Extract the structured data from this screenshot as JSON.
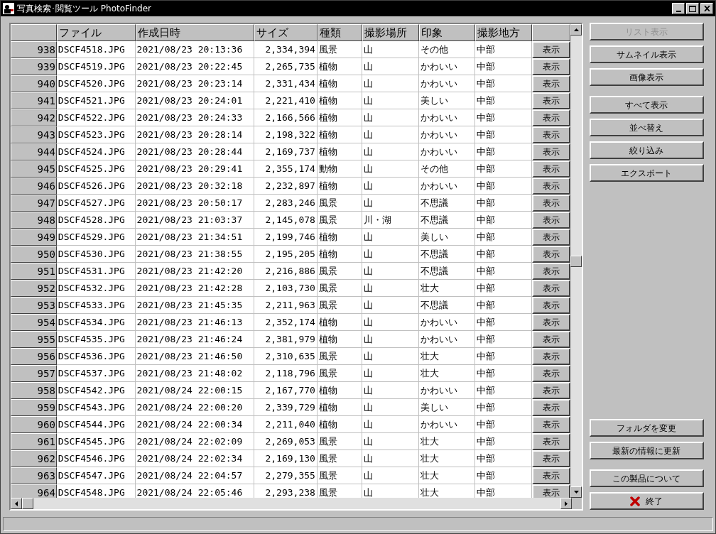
{
  "window": {
    "title": "写真検索･閲覧ツール PhotoFinder"
  },
  "table": {
    "columns": [
      "ファイル",
      "作成日時",
      "サイズ",
      "種類",
      "撮影場所",
      "印象",
      "撮影地方"
    ],
    "rows": [
      {
        "no": "938",
        "file": "DSCF4518.JPG",
        "created": "2021/08/23 20:13:36",
        "size": "2,334,394",
        "type": "風景",
        "place": "山",
        "impression": "その他",
        "region": "中部",
        "action": "表示"
      },
      {
        "no": "939",
        "file": "DSCF4519.JPG",
        "created": "2021/08/23 20:22:45",
        "size": "2,265,735",
        "type": "植物",
        "place": "山",
        "impression": "かわいい",
        "region": "中部",
        "action": "表示"
      },
      {
        "no": "940",
        "file": "DSCF4520.JPG",
        "created": "2021/08/23 20:23:14",
        "size": "2,331,434",
        "type": "植物",
        "place": "山",
        "impression": "かわいい",
        "region": "中部",
        "action": "表示"
      },
      {
        "no": "941",
        "file": "DSCF4521.JPG",
        "created": "2021/08/23 20:24:01",
        "size": "2,221,410",
        "type": "植物",
        "place": "山",
        "impression": "美しい",
        "region": "中部",
        "action": "表示"
      },
      {
        "no": "942",
        "file": "DSCF4522.JPG",
        "created": "2021/08/23 20:24:33",
        "size": "2,166,566",
        "type": "植物",
        "place": "山",
        "impression": "かわいい",
        "region": "中部",
        "action": "表示"
      },
      {
        "no": "943",
        "file": "DSCF4523.JPG",
        "created": "2021/08/23 20:28:14",
        "size": "2,198,322",
        "type": "植物",
        "place": "山",
        "impression": "かわいい",
        "region": "中部",
        "action": "表示"
      },
      {
        "no": "944",
        "file": "DSCF4524.JPG",
        "created": "2021/08/23 20:28:44",
        "size": "2,169,737",
        "type": "植物",
        "place": "山",
        "impression": "かわいい",
        "region": "中部",
        "action": "表示"
      },
      {
        "no": "945",
        "file": "DSCF4525.JPG",
        "created": "2021/08/23 20:29:41",
        "size": "2,355,174",
        "type": "動物",
        "place": "山",
        "impression": "その他",
        "region": "中部",
        "action": "表示"
      },
      {
        "no": "946",
        "file": "DSCF4526.JPG",
        "created": "2021/08/23 20:32:18",
        "size": "2,232,897",
        "type": "植物",
        "place": "山",
        "impression": "かわいい",
        "region": "中部",
        "action": "表示"
      },
      {
        "no": "947",
        "file": "DSCF4527.JPG",
        "created": "2021/08/23 20:50:17",
        "size": "2,283,246",
        "type": "風景",
        "place": "山",
        "impression": "不思議",
        "region": "中部",
        "action": "表示"
      },
      {
        "no": "948",
        "file": "DSCF4528.JPG",
        "created": "2021/08/23 21:03:37",
        "size": "2,145,078",
        "type": "風景",
        "place": "川・湖",
        "impression": "不思議",
        "region": "中部",
        "action": "表示"
      },
      {
        "no": "949",
        "file": "DSCF4529.JPG",
        "created": "2021/08/23 21:34:51",
        "size": "2,199,746",
        "type": "植物",
        "place": "山",
        "impression": "美しい",
        "region": "中部",
        "action": "表示"
      },
      {
        "no": "950",
        "file": "DSCF4530.JPG",
        "created": "2021/08/23 21:38:55",
        "size": "2,195,205",
        "type": "植物",
        "place": "山",
        "impression": "不思議",
        "region": "中部",
        "action": "表示"
      },
      {
        "no": "951",
        "file": "DSCF4531.JPG",
        "created": "2021/08/23 21:42:20",
        "size": "2,216,886",
        "type": "風景",
        "place": "山",
        "impression": "不思議",
        "region": "中部",
        "action": "表示"
      },
      {
        "no": "952",
        "file": "DSCF4532.JPG",
        "created": "2021/08/23 21:42:28",
        "size": "2,103,730",
        "type": "風景",
        "place": "山",
        "impression": "壮大",
        "region": "中部",
        "action": "表示"
      },
      {
        "no": "953",
        "file": "DSCF4533.JPG",
        "created": "2021/08/23 21:45:35",
        "size": "2,211,963",
        "type": "風景",
        "place": "山",
        "impression": "不思議",
        "region": "中部",
        "action": "表示"
      },
      {
        "no": "954",
        "file": "DSCF4534.JPG",
        "created": "2021/08/23 21:46:13",
        "size": "2,352,174",
        "type": "植物",
        "place": "山",
        "impression": "かわいい",
        "region": "中部",
        "action": "表示"
      },
      {
        "no": "955",
        "file": "DSCF4535.JPG",
        "created": "2021/08/23 21:46:24",
        "size": "2,381,979",
        "type": "植物",
        "place": "山",
        "impression": "かわいい",
        "region": "中部",
        "action": "表示"
      },
      {
        "no": "956",
        "file": "DSCF4536.JPG",
        "created": "2021/08/23 21:46:50",
        "size": "2,310,635",
        "type": "風景",
        "place": "山",
        "impression": "壮大",
        "region": "中部",
        "action": "表示"
      },
      {
        "no": "957",
        "file": "DSCF4537.JPG",
        "created": "2021/08/23 21:48:02",
        "size": "2,118,796",
        "type": "風景",
        "place": "山",
        "impression": "壮大",
        "region": "中部",
        "action": "表示"
      },
      {
        "no": "958",
        "file": "DSCF4542.JPG",
        "created": "2021/08/24 22:00:15",
        "size": "2,167,770",
        "type": "植物",
        "place": "山",
        "impression": "かわいい",
        "region": "中部",
        "action": "表示"
      },
      {
        "no": "959",
        "file": "DSCF4543.JPG",
        "created": "2021/08/24 22:00:20",
        "size": "2,339,729",
        "type": "植物",
        "place": "山",
        "impression": "美しい",
        "region": "中部",
        "action": "表示"
      },
      {
        "no": "960",
        "file": "DSCF4544.JPG",
        "created": "2021/08/24 22:00:34",
        "size": "2,211,040",
        "type": "植物",
        "place": "山",
        "impression": "かわいい",
        "region": "中部",
        "action": "表示"
      },
      {
        "no": "961",
        "file": "DSCF4545.JPG",
        "created": "2021/08/24 22:02:09",
        "size": "2,269,053",
        "type": "風景",
        "place": "山",
        "impression": "壮大",
        "region": "中部",
        "action": "表示"
      },
      {
        "no": "962",
        "file": "DSCF4546.JPG",
        "created": "2021/08/24 22:02:34",
        "size": "2,169,130",
        "type": "風景",
        "place": "山",
        "impression": "壮大",
        "region": "中部",
        "action": "表示"
      },
      {
        "no": "963",
        "file": "DSCF4547.JPG",
        "created": "2021/08/24 22:04:57",
        "size": "2,279,355",
        "type": "風景",
        "place": "山",
        "impression": "壮大",
        "region": "中部",
        "action": "表示"
      },
      {
        "no": "964",
        "file": "DSCF4548.JPG",
        "created": "2021/08/24 22:05:46",
        "size": "2,293,238",
        "type": "風景",
        "place": "山",
        "impression": "壮大",
        "region": "中部",
        "action": "表示"
      }
    ]
  },
  "side_buttons": {
    "top": [
      [
        {
          "label": "リスト表示",
          "disabled": true,
          "kind": "plain"
        },
        {
          "label": "サムネイル表示",
          "disabled": false,
          "kind": "plain"
        },
        {
          "label": "画像表示",
          "disabled": false,
          "kind": "plain"
        }
      ],
      [
        {
          "label": "すべて表示",
          "disabled": false,
          "kind": "plain"
        },
        {
          "label": "並べ替え",
          "disabled": false,
          "kind": "plain"
        },
        {
          "label": "絞り込み",
          "disabled": false,
          "kind": "plain"
        },
        {
          "label": "エクスポート",
          "disabled": false,
          "kind": "plain"
        }
      ]
    ],
    "bottom": [
      [
        {
          "label": "フォルダを変更",
          "disabled": false,
          "kind": "plain"
        },
        {
          "label": "最新の情報に更新",
          "disabled": false,
          "kind": "plain"
        }
      ],
      [
        {
          "label": "この製品について",
          "disabled": false,
          "kind": "plain"
        },
        {
          "label": "終了",
          "disabled": false,
          "kind": "exit"
        }
      ]
    ]
  }
}
